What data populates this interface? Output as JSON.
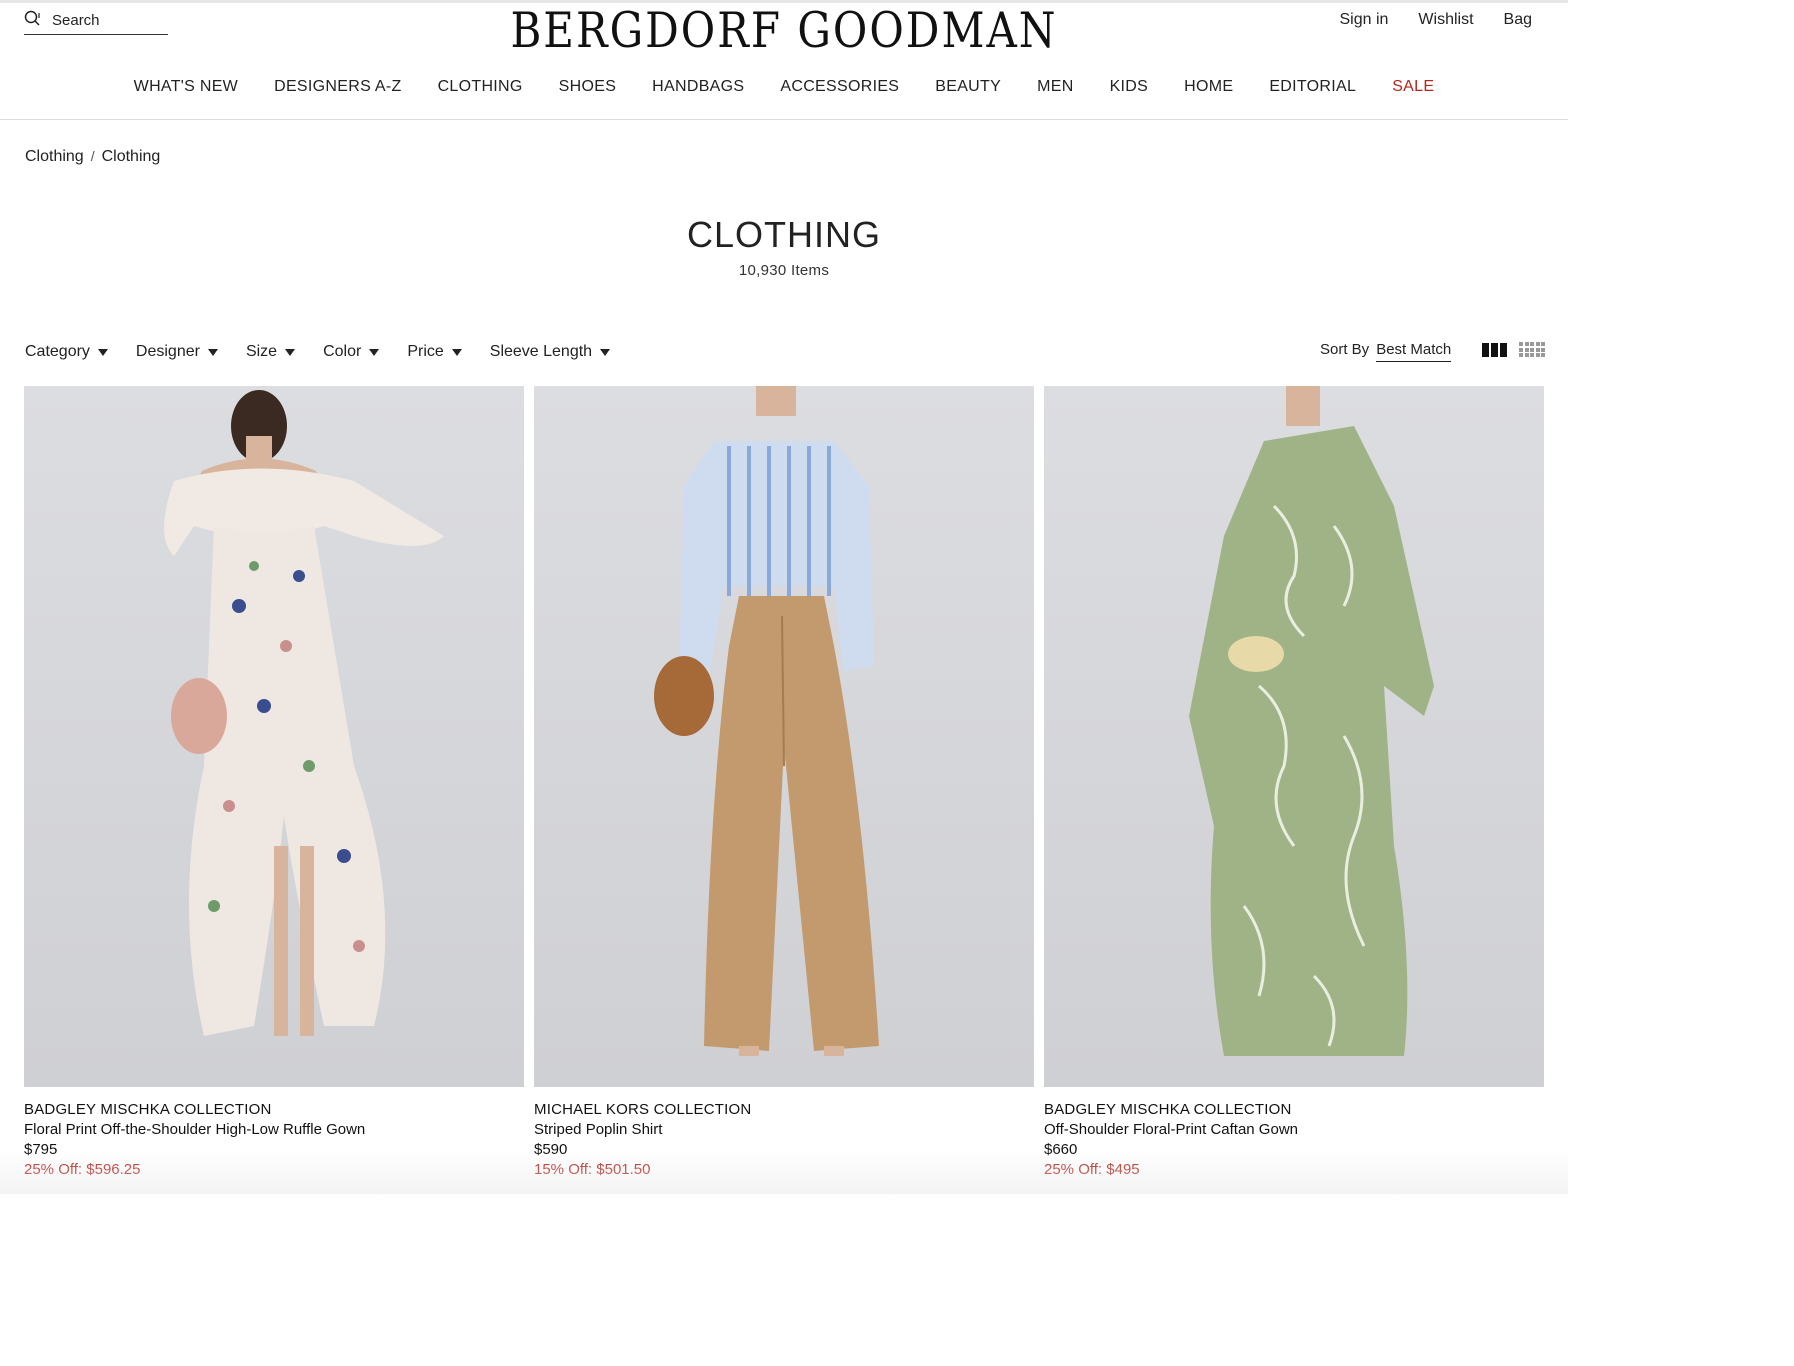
{
  "header": {
    "search_placeholder": "Search",
    "logo": "BERGDORF GOODMAN",
    "links": [
      "Sign in",
      "Wishlist",
      "Bag"
    ]
  },
  "nav": {
    "items": [
      "WHAT'S NEW",
      "DESIGNERS A-Z",
      "CLOTHING",
      "SHOES",
      "HANDBAGS",
      "ACCESSORIES",
      "BEAUTY",
      "MEN",
      "KIDS",
      "HOME",
      "EDITORIAL"
    ],
    "sale": "SALE",
    "sale_color": "#b3261e"
  },
  "breadcrumb": [
    "Clothing",
    "Clothing"
  ],
  "breadcrumb_separator": "/",
  "page": {
    "title": "CLOTHING",
    "count": "10,930 Items"
  },
  "filters": [
    "Category",
    "Designer",
    "Size",
    "Color",
    "Price",
    "Sleeve Length"
  ],
  "sort": {
    "label": "Sort By",
    "value": "Best Match"
  },
  "products": [
    {
      "designer": "BADGLEY MISCHKA COLLECTION",
      "name": "Floral Print Off-the-Shoulder High-Low Ruffle Gown",
      "price": "$795",
      "promo": "25% Off: $596.25"
    },
    {
      "designer": "MICHAEL KORS COLLECTION",
      "name": "Striped Poplin Shirt",
      "price": "$590",
      "promo": "15% Off: $501.50"
    },
    {
      "designer": "BADGLEY MISCHKA COLLECTION",
      "name": "Off-Shoulder Floral-Print Caftan Gown",
      "price": "$660",
      "promo": "25% Off: $495"
    }
  ]
}
